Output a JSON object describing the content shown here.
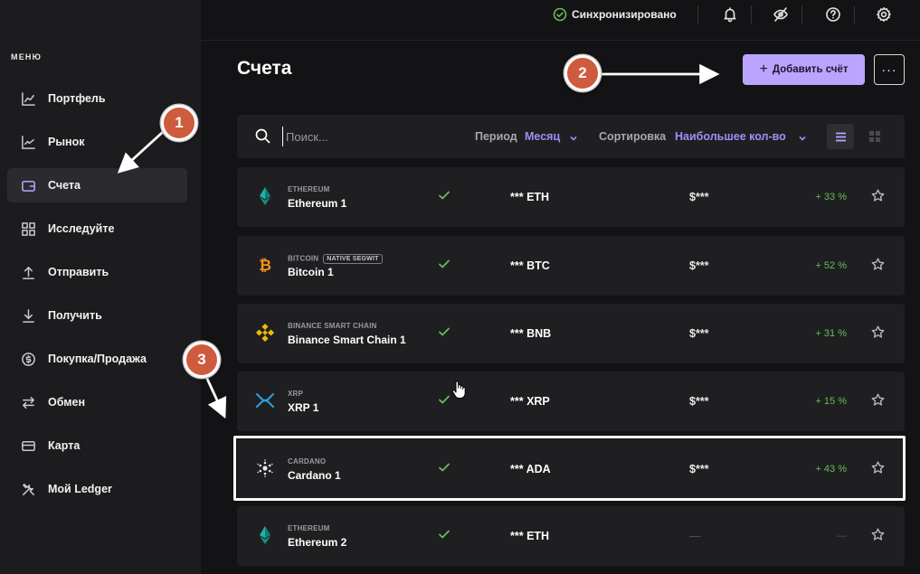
{
  "sidebar": {
    "menu_label": "МЕНЮ",
    "items": [
      {
        "label": "Портфель",
        "icon": "chart-line-icon"
      },
      {
        "label": "Рынок",
        "icon": "trend-icon"
      },
      {
        "label": "Счета",
        "icon": "wallet-icon",
        "active": true
      },
      {
        "label": "Исследуйте",
        "icon": "grid-icon"
      },
      {
        "label": "Отправить",
        "icon": "send-arrow-up-icon"
      },
      {
        "label": "Получить",
        "icon": "receive-arrow-down-icon"
      },
      {
        "label": "Покупка/Продажа",
        "icon": "dollar-circle-icon"
      },
      {
        "label": "Обмен",
        "icon": "swap-icon"
      },
      {
        "label": "Карта",
        "icon": "card-icon"
      },
      {
        "label": "Мой Ledger",
        "icon": "tools-icon"
      }
    ]
  },
  "topbar": {
    "sync_status": "Синхронизировано",
    "sync_color": "#66be54"
  },
  "header": {
    "title": "Счета",
    "add_button": "Добавить счёт",
    "more_button": "···"
  },
  "filters": {
    "search_placeholder": "Поиск...",
    "period_label": "Период",
    "period_value": "Месяц",
    "sort_label": "Сортировка",
    "sort_value": "Наибольшее кол-во"
  },
  "accounts": [
    {
      "network": "ETHEREUM",
      "tag": "",
      "name": "Ethereum 1",
      "amount": "*** ETH",
      "fiat": "$***",
      "change": "+ 33 %",
      "coin": "ethereum-icon"
    },
    {
      "network": "BITCOIN",
      "tag": "NATIVE SEGWIT",
      "name": "Bitcoin 1",
      "amount": "*** BTC",
      "fiat": "$***",
      "change": "+ 52 %",
      "coin": "bitcoin-icon"
    },
    {
      "network": "BINANCE SMART CHAIN",
      "tag": "",
      "name": "Binance Smart Chain 1",
      "amount": "*** BNB",
      "fiat": "$***",
      "change": "+ 31 %",
      "coin": "binance-icon"
    },
    {
      "network": "XRP",
      "tag": "",
      "name": "XRP 1",
      "amount": "*** XRP",
      "fiat": "$***",
      "change": "+ 15 %",
      "coin": "xrp-icon"
    },
    {
      "network": "CARDANO",
      "tag": "",
      "name": "Cardano 1",
      "amount": "*** ADA",
      "fiat": "$***",
      "change": "+ 43 %",
      "coin": "cardano-icon"
    },
    {
      "network": "ETHEREUM",
      "tag": "",
      "name": "Ethereum 2",
      "amount": "*** ETH",
      "fiat": "—",
      "change": "—",
      "coin": "ethereum-icon"
    }
  ],
  "annotations": {
    "step1": "1",
    "step2": "2",
    "step3": "3"
  },
  "colors": {
    "accent": "#bba4ff",
    "positive": "#66be54",
    "badge": "#cf5b3e"
  }
}
